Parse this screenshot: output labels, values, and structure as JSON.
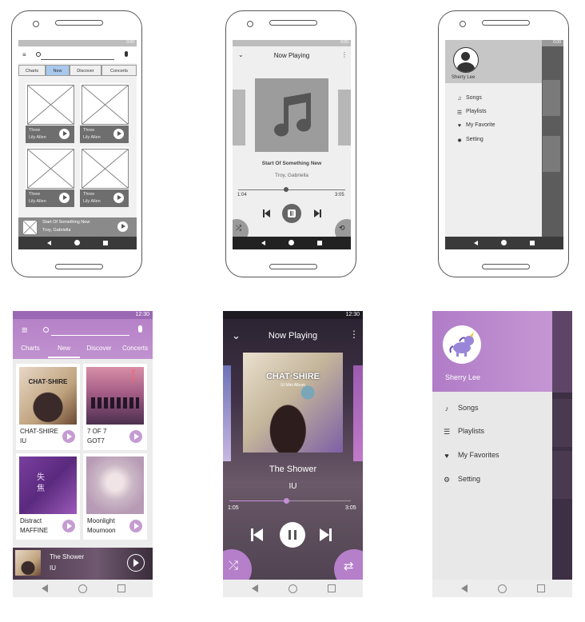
{
  "wire_browse": {
    "status_time": "0:00",
    "tabs": [
      "Charts",
      "New",
      "Discover",
      "Concerts"
    ],
    "active_tab": "New",
    "tiles": [
      {
        "title": "Three",
        "artist": "Lily Allen"
      },
      {
        "title": "Three",
        "artist": "Lily Allen"
      },
      {
        "title": "Three",
        "artist": "Lily Allen"
      },
      {
        "title": "Three",
        "artist": "Lily Allen"
      }
    ],
    "mini_player": {
      "title": "Start Of Something New",
      "artist": "Troy, Gabriella"
    }
  },
  "wire_player": {
    "status_time": "0:00",
    "header_title": "Now Playing",
    "song_title": "Start Of Something New",
    "song_artist": "Troy, Gabriella",
    "elapsed": "1:04",
    "duration": "3:05",
    "progress": 0.45
  },
  "wire_drawer": {
    "status_time": "0:00",
    "user_name": "Sherry Lee",
    "menu": [
      {
        "label": "Songs",
        "icon": "music-note-icon"
      },
      {
        "label": "Playlists",
        "icon": "list-icon"
      },
      {
        "label": "My Favorite",
        "icon": "heart-icon"
      },
      {
        "label": "Setting",
        "icon": "gear-icon"
      }
    ]
  },
  "color_browse": {
    "status_time": "12:30",
    "tabs": [
      "Charts",
      "New",
      "Discover",
      "Concerts"
    ],
    "active_tab": "New",
    "tiles": [
      {
        "title": "CHAT-SHIRE",
        "artist": "IU",
        "art_text": "CHAT·SHIRE"
      },
      {
        "title": "7 OF 7",
        "artist": "GOT7",
        "art_text": "7 7"
      },
      {
        "title": "Distract",
        "artist": "MAFFINE",
        "art_text": "失 焦"
      },
      {
        "title": "Moonlight",
        "artist": "Moumoon",
        "art_text": ""
      }
    ],
    "mini_player": {
      "title": "The Shower",
      "artist": "IU"
    }
  },
  "color_player": {
    "status_time": "12:30",
    "header_title": "Now Playing",
    "album_text": "CHAT·SHIRE",
    "album_subtext": "IU Mini Album",
    "song_title": "The Shower",
    "song_artist": "IU",
    "elapsed": "1:05",
    "duration": "3:05",
    "progress": 0.47
  },
  "color_drawer": {
    "user_name": "Sherry Lee",
    "menu": [
      {
        "label": "Songs",
        "icon": "music-note-icon"
      },
      {
        "label": "Playlists",
        "icon": "list-icon"
      },
      {
        "label": "My Favorites",
        "icon": "heart-icon"
      },
      {
        "label": "Setting",
        "icon": "gear-icon"
      }
    ]
  },
  "colors": {
    "accent": "#b785c9",
    "accent_dark": "#8f63a8",
    "wire_gray": "#6e6e6e"
  }
}
